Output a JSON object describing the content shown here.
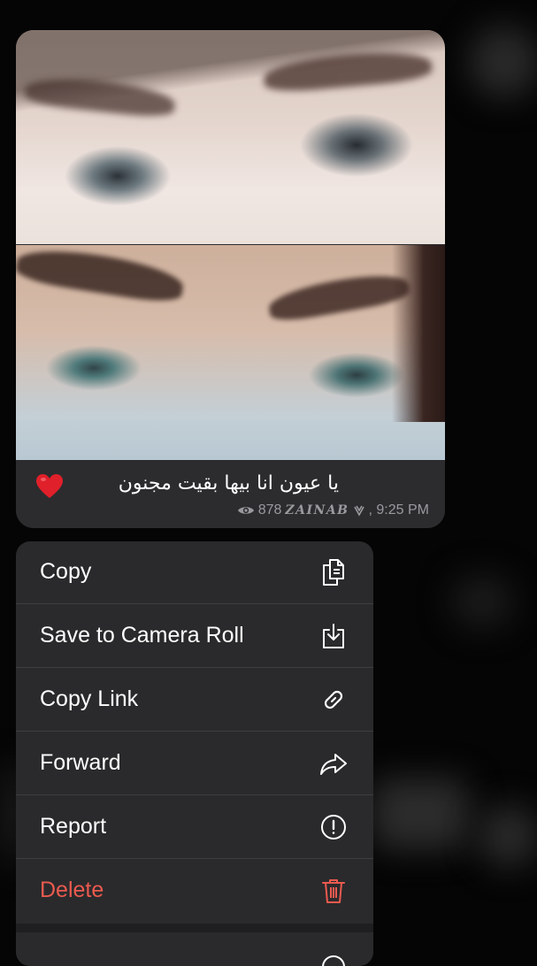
{
  "message": {
    "caption": "يا عيون انا بيها بقيت مجنون",
    "caption_emoji": "heart",
    "views": "878",
    "author": "ZAINAB",
    "time": ", 9:25 PM"
  },
  "context_menu": {
    "items": [
      {
        "label": "Copy",
        "icon": "copy-icon"
      },
      {
        "label": "Save to Camera Roll",
        "icon": "save-download-icon"
      },
      {
        "label": "Copy Link",
        "icon": "link-icon"
      },
      {
        "label": "Forward",
        "icon": "forward-icon"
      },
      {
        "label": "Report",
        "icon": "report-exclamation-icon"
      },
      {
        "label": "Delete",
        "icon": "trash-icon",
        "destructive": true
      }
    ]
  },
  "colors": {
    "destructive": "#eb5a4f",
    "menu_background": "#2a2a2c",
    "caption_background": "#2c2c2f",
    "meta_text": "#9a9a9e",
    "heart": "#e0202a"
  }
}
